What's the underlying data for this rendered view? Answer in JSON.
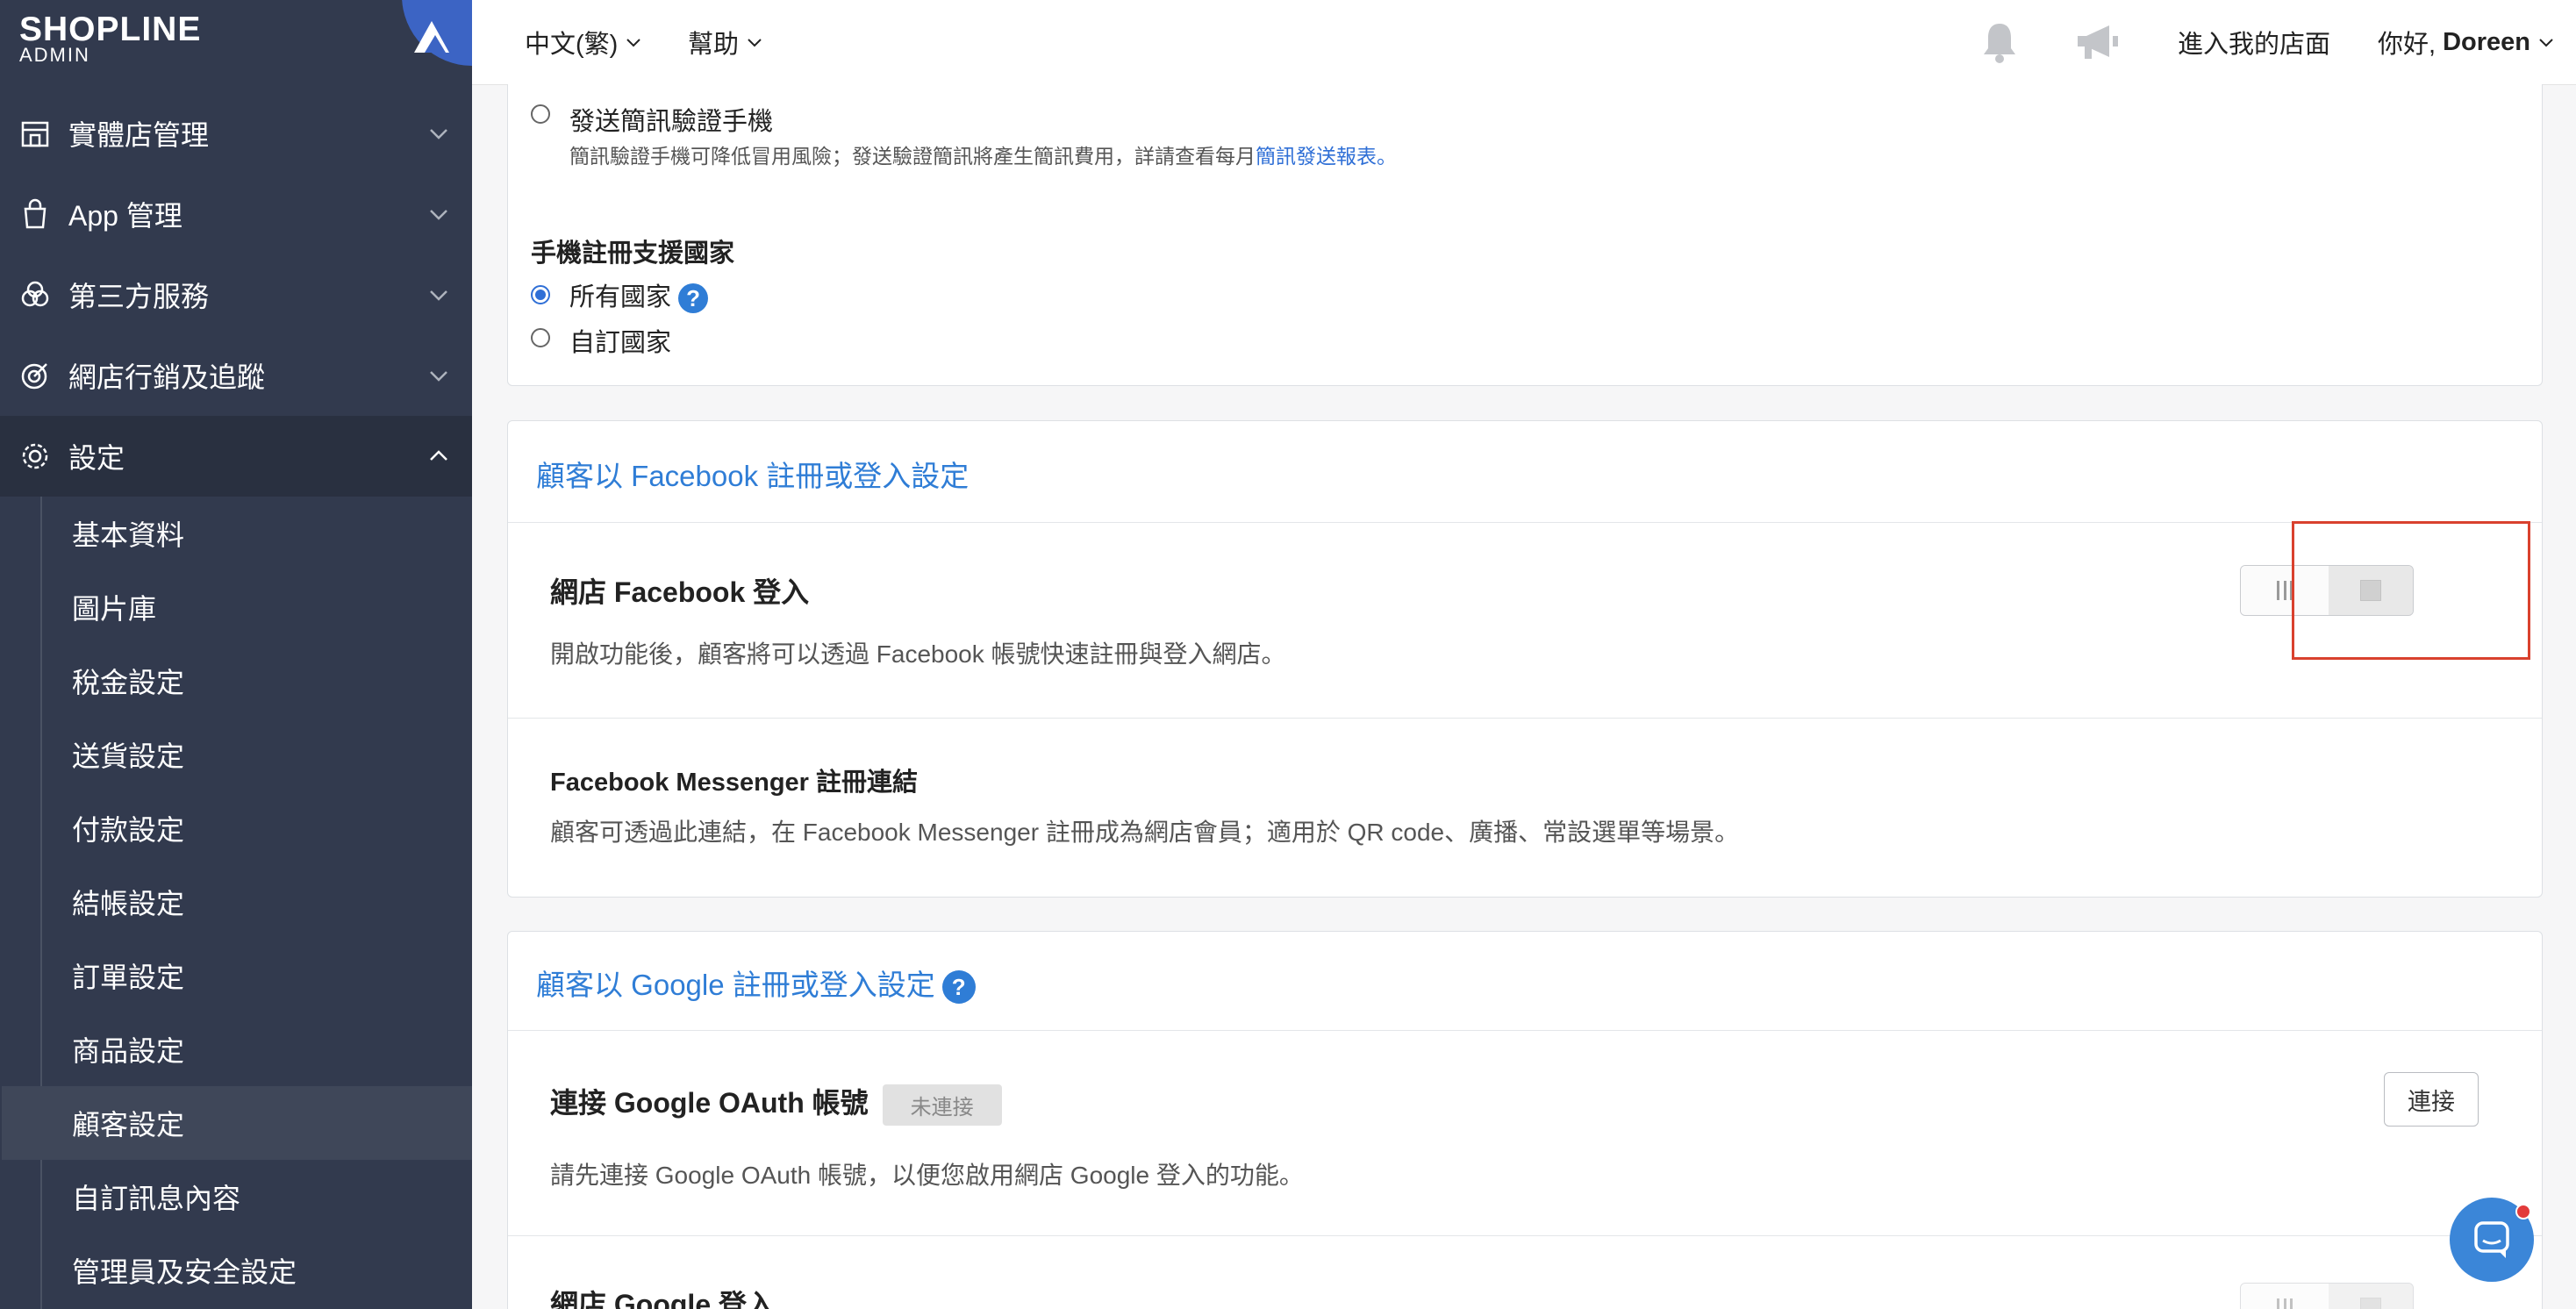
{
  "brand": {
    "logo_main": "SHOPLINE",
    "logo_sub": "ADMIN"
  },
  "sidebar": {
    "items": [
      {
        "label": "實體店管理",
        "icon": "store-icon"
      },
      {
        "label": "App 管理",
        "icon": "bag-icon"
      },
      {
        "label": "第三方服務",
        "icon": "circles-icon"
      },
      {
        "label": "網店行銷及追蹤",
        "icon": "target-icon"
      },
      {
        "label": "設定",
        "icon": "gear-icon"
      }
    ],
    "sub_items": [
      {
        "label": "基本資料"
      },
      {
        "label": "圖片庫"
      },
      {
        "label": "稅金設定"
      },
      {
        "label": "送貨設定"
      },
      {
        "label": "付款設定"
      },
      {
        "label": "結帳設定"
      },
      {
        "label": "訂單設定"
      },
      {
        "label": "商品設定"
      },
      {
        "label": "顧客設定"
      },
      {
        "label": "自訂訊息內容"
      },
      {
        "label": "管理員及安全設定"
      }
    ]
  },
  "topbar": {
    "language": "中文(繁)",
    "help": "幫助",
    "enter_store": "進入我的店面",
    "greeting_prefix": "你好,",
    "user_name": "Doreen"
  },
  "sms_section": {
    "radio_label": "發送簡訊驗證手機",
    "desc": "簡訊驗證手機可降低冒用風險；發送驗證簡訊將產生簡訊費用，詳請查看每月",
    "desc_link": "簡訊發送報表。",
    "countries_title": "手機註冊支援國家",
    "option_all": "所有國家",
    "option_custom": "自訂國家"
  },
  "facebook_section": {
    "title": "顧客以 Facebook 註冊或登入設定",
    "login_title": "網店 Facebook 登入",
    "login_desc": "開啟功能後，顧客將可以透過 Facebook 帳號快速註冊與登入網店。",
    "login_enabled": false,
    "messenger_title": "Facebook Messenger 註冊連結",
    "messenger_desc": "顧客可透過此連結，在 Facebook Messenger 註冊成為網店會員；適用於 QR code、廣播、常設選單等場景。"
  },
  "google_section": {
    "title": "顧客以 Google 註冊或登入設定",
    "oauth_title": "連接 Google OAuth 帳號",
    "oauth_status": "未連接",
    "connect_button": "連接",
    "oauth_desc": "請先連接 Google OAuth 帳號，以便您啟用網店 Google 登入的功能。",
    "google_login_title": "網店 Google 登入"
  },
  "colors": {
    "sidebar": "#323a4e",
    "accent": "#2f7dd6",
    "highlight": "#d9412e"
  }
}
